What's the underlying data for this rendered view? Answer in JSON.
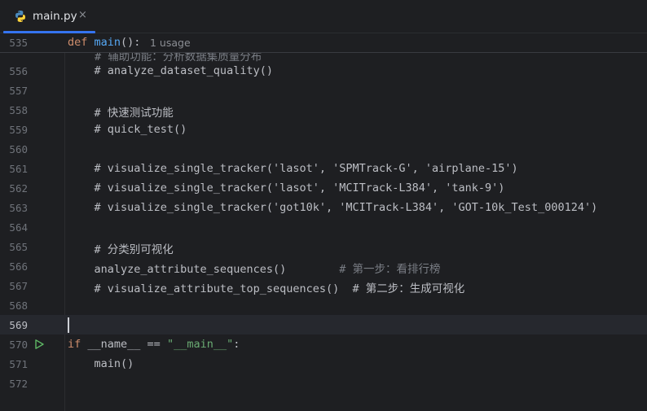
{
  "tab": {
    "filename": "main.py",
    "close_glyph": "×",
    "icon": "python-icon"
  },
  "sticky": {
    "line_number": "535",
    "keyword": "def",
    "function": "main",
    "rest": "():",
    "hint": "1 usage"
  },
  "peek_line": "# 辅助功能：分析数据集质量分布",
  "lines": [
    {
      "n": "556",
      "text": "    # analyze_dataset_quality()"
    },
    {
      "n": "557",
      "text": ""
    },
    {
      "n": "558",
      "text": "    # 快速测试功能"
    },
    {
      "n": "559",
      "text": "    # quick_test()"
    },
    {
      "n": "560",
      "text": ""
    },
    {
      "n": "561",
      "text": "    # visualize_single_tracker('lasot', 'SPMTrack-G', 'airplane-15')"
    },
    {
      "n": "562",
      "text": "    # visualize_single_tracker('lasot', 'MCITrack-L384', 'tank-9')"
    },
    {
      "n": "563",
      "text": "    # visualize_single_tracker('got10k', 'MCITrack-L384', 'GOT-10k_Test_000124')"
    },
    {
      "n": "564",
      "text": ""
    },
    {
      "n": "565",
      "text": "    # 分类别可视化"
    },
    {
      "n": "566",
      "code": "    analyze_attribute_sequences()",
      "comment": "        # 第一步：看排行榜"
    },
    {
      "n": "567",
      "text": "    # visualize_attribute_top_sequences()  # 第二步：生成可视化"
    },
    {
      "n": "568",
      "text": ""
    },
    {
      "n": "569",
      "text": ""
    },
    {
      "n": "570",
      "kw": "if",
      "plain": " __name__ == ",
      "str": "\"__main__\"",
      "end": ":"
    },
    {
      "n": "571",
      "text": "    main()"
    },
    {
      "n": "572",
      "text": ""
    }
  ]
}
